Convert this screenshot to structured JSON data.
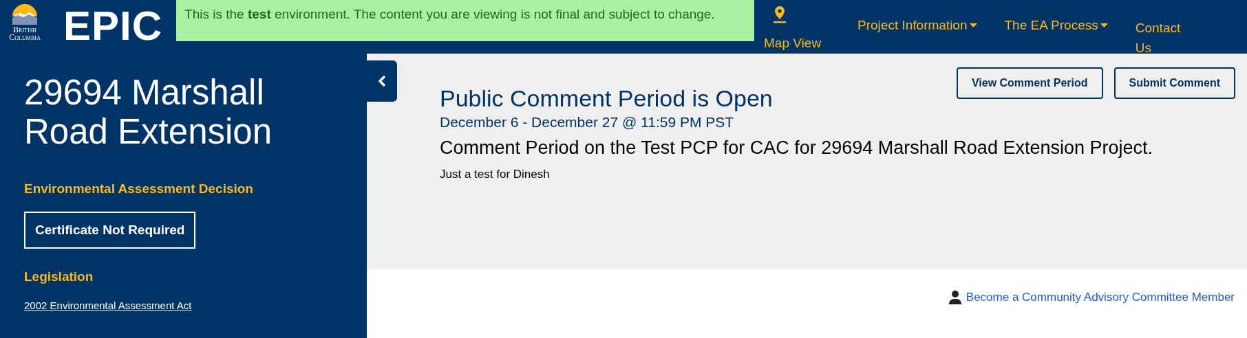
{
  "header": {
    "logo_text": "British Columbia",
    "site_title": "EPIC",
    "notice": "This is the **test** environment. The content you are viewing is not final and subject to change.",
    "nav": [
      {
        "label": "Map View",
        "kind": "icon-link"
      },
      {
        "label": "Project Information",
        "kind": "dropdown"
      },
      {
        "label": "The EA Process",
        "kind": "dropdown"
      },
      {
        "label": "Contact Us",
        "kind": "link"
      }
    ]
  },
  "sidebar": {
    "title": "29694 Marshall Road Extension",
    "decision_label": "Environmental Assessment Decision",
    "decision": "Certificate Not Required",
    "legislation_label": "Legislation",
    "legislation_link": "2002 Environmental Assessment Act"
  },
  "comment_period": {
    "heading": "Public Comment Period is Open",
    "dates": "December 6 - December 27 @ 11:59 PM PST",
    "title": "Comment Period on the Test PCP for CAC for 29694 Marshall Road Extension Project.",
    "description": "Just a test for Dinesh",
    "buttons": [
      "View Comment Period",
      "Submit Comment"
    ]
  },
  "cac_link": "Become a Community Advisory Committee Member"
}
